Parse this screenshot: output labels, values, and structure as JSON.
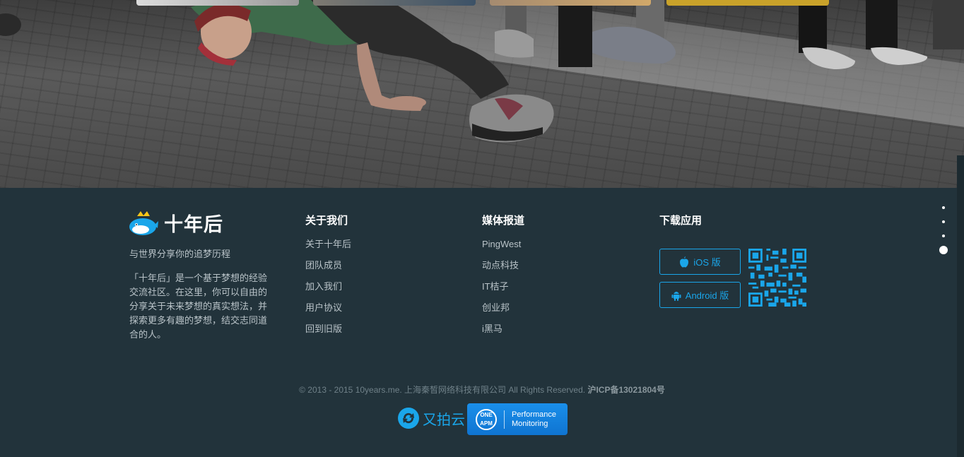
{
  "hero": {
    "thumbnail_colors": [
      "#d6d6d6",
      "#9a8f86",
      "#3c5267",
      "#b89a6f",
      "#c9a22a"
    ]
  },
  "brand": {
    "name": "十年后",
    "slogan": "与世界分享你的追梦历程",
    "description": "「十年后」是一个基于梦想的经验交流社区。在这里，你可以自由的分享关于未来梦想的真实想法，并探索更多有趣的梦想，结交志同道合的人。",
    "logo_icon": "whale-crown-icon"
  },
  "about": {
    "title": "关于我们",
    "links": [
      "关于十年后",
      "团队成员",
      "加入我们",
      "用户协议",
      "回到旧版"
    ]
  },
  "media": {
    "title": "媒体报道",
    "links": [
      "PingWest",
      "动点科技",
      "IT桔子",
      "创业邦",
      "i黑马"
    ]
  },
  "download": {
    "title": "下载应用",
    "ios_label": "iOS 版",
    "android_label": "Android 版",
    "qr_icon": "qr-code-icon"
  },
  "copyright": {
    "text": "© 2013 - 2015 10years.me. 上海秦皙网络科技有限公司 All Rights Reserved.",
    "icp": "沪ICP备13021804号"
  },
  "sponsors": {
    "upyun": "又拍云",
    "oneapm_logo": "ONE APM",
    "oneapm_line1": "Performance",
    "oneapm_line2": "Monitoring"
  },
  "page_dots": {
    "count": 4,
    "active_index": 3
  },
  "colors": {
    "accent": "#1aa6ea",
    "footer_bg": "#22333b"
  }
}
